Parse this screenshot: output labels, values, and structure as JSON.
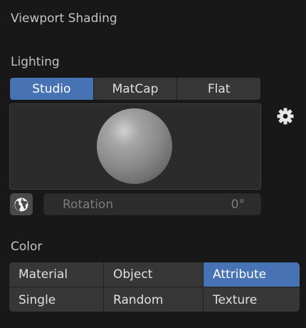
{
  "panel": {
    "title": "Viewport Shading"
  },
  "lighting": {
    "label": "Lighting",
    "options": [
      "Studio",
      "MatCap",
      "Flat"
    ],
    "selected": "Studio",
    "rotation_label": "Rotation",
    "rotation_value": "0°"
  },
  "color": {
    "label": "Color",
    "options": [
      "Material",
      "Object",
      "Attribute",
      "Single",
      "Random",
      "Texture"
    ],
    "selected": "Attribute"
  },
  "icons": {
    "settings": "gear-icon",
    "world_space": "world-icon"
  },
  "colors": {
    "accent": "#4772b3",
    "background": "#181818",
    "button": "#373737"
  }
}
